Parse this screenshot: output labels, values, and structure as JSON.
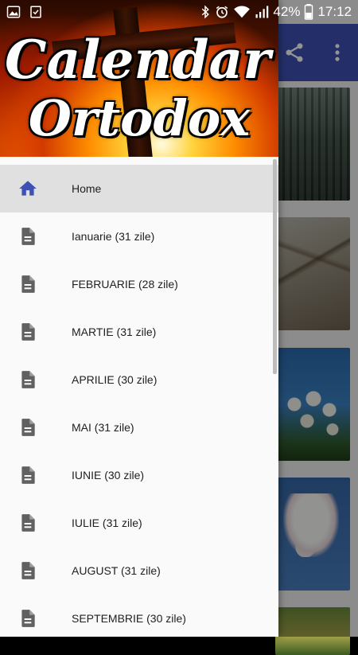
{
  "status_bar": {
    "battery_percent": "42%",
    "time": "17:12",
    "icons": [
      "image-icon",
      "checklist-icon",
      "bluetooth-icon",
      "alarm-icon",
      "wifi-icon",
      "signal-icon",
      "battery-icon"
    ]
  },
  "app_toolbar": {
    "color": "#3f51b5",
    "icons": [
      "share-icon",
      "more-vert-icon"
    ]
  },
  "drawer": {
    "header": {
      "title_line1": "Calendar",
      "title_line2": "Ortodox"
    },
    "accent_color": "#3f51b5",
    "items": [
      {
        "label": "Home",
        "icon": "home-icon",
        "selected": true
      },
      {
        "label": "Ianuarie (31 zile)",
        "icon": "document-icon"
      },
      {
        "label": "FEBRUARIE (28 zile)",
        "icon": "document-icon"
      },
      {
        "label": "MARTIE (31 zile)",
        "icon": "document-icon"
      },
      {
        "label": "APRILIE (30 zile)",
        "icon": "document-icon"
      },
      {
        "label": "MAI (31 zile)",
        "icon": "document-icon"
      },
      {
        "label": "IUNIE (30 zile)",
        "icon": "document-icon"
      },
      {
        "label": "IULIE (31 zile)",
        "icon": "document-icon"
      },
      {
        "label": "AUGUST (31 zile)",
        "icon": "document-icon"
      },
      {
        "label": "SEPTEMBRIE (30 zile)",
        "icon": "document-icon"
      }
    ]
  }
}
